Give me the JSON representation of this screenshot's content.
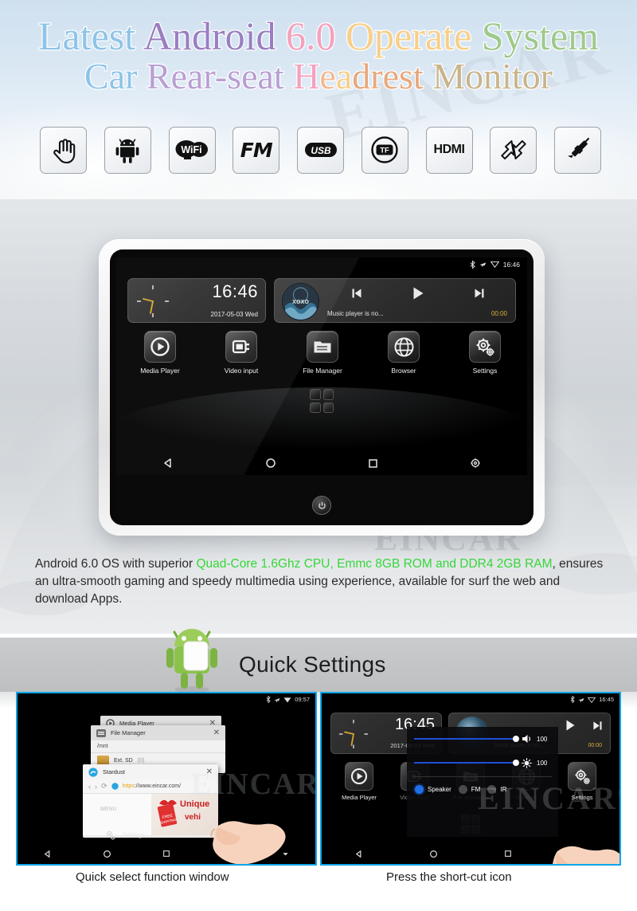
{
  "hero": {
    "watermark": "EINCAR",
    "title_line1": [
      {
        "text": "Latest ",
        "color": "#8fc4e8"
      },
      {
        "text": "Android ",
        "color": "#9a7fc0"
      },
      {
        "text": "6.0 ",
        "color": "#f3a2bd"
      },
      {
        "text": "Operate ",
        "color": "#f7cf8a"
      },
      {
        "text": "System",
        "color": "#9fc98d"
      }
    ],
    "title_line2": [
      {
        "text": "Car ",
        "color": "#8fc4e8"
      },
      {
        "text": "Rear-seat ",
        "color": "#b99fd2"
      },
      {
        "text": "H",
        "color": "#f3a2bd"
      },
      {
        "text": "e",
        "color": "#f5b98e"
      },
      {
        "text": "a",
        "color": "#f7cf8a"
      },
      {
        "text": "drest ",
        "color": "#e8a87c"
      },
      {
        "text": "Monitor",
        "color": "#c9b48a"
      }
    ],
    "title_text_1": "Latest Android 6.0 Operate System",
    "title_text_2": "Car Rear-seat Headrest Monitor"
  },
  "features": [
    {
      "name": "touch-gesture-icon",
      "label": "Touch"
    },
    {
      "name": "android-robot-icon",
      "label": "Android"
    },
    {
      "name": "wifi-icon",
      "label": "WiFi"
    },
    {
      "name": "fm-icon",
      "label": "FM"
    },
    {
      "name": "usb-icon",
      "label": "USB"
    },
    {
      "name": "tf-card-icon",
      "label": "TF"
    },
    {
      "name": "hdmi-icon",
      "label": "HDMI"
    },
    {
      "name": "mirror-link-icon",
      "label": "Mirror Link"
    },
    {
      "name": "av-cable-icon",
      "label": "AV Cable"
    }
  ],
  "device": {
    "band_watermark": "EINCAR",
    "band_watermark_sup": "®",
    "status_bar": {
      "time": "16:46",
      "icons": [
        "bluetooth-icon",
        "airplane-icon",
        "wifi-signal-icon"
      ]
    },
    "clock_widget": {
      "time": "16:46",
      "date": "2017-05-03  Wed"
    },
    "music_widget": {
      "title": "Music player is no...",
      "elapsed": "00:00",
      "controls": [
        "previous-track-icon",
        "play-icon",
        "next-track-icon"
      ]
    },
    "apps": [
      {
        "label": "Media Player",
        "icon": "media-player-icon"
      },
      {
        "label": "Video input",
        "icon": "video-input-icon"
      },
      {
        "label": "File Manager",
        "icon": "file-manager-icon"
      },
      {
        "label": "Browser",
        "icon": "browser-globe-icon"
      },
      {
        "label": "Settings",
        "icon": "settings-gears-icon"
      }
    ],
    "nav_buttons": [
      "back-icon",
      "home-icon",
      "recents-icon",
      "quick-settings-icon"
    ],
    "app_drawer": "app-drawer-grid-button",
    "power_button": "power-button"
  },
  "description": {
    "part1": "Android 6.0 OS with superior ",
    "highlight1": "Quad-Core 1.6Ghz CPU, Emmc 8GB ROM and DDR4 2GB RAM",
    "part2": ", ensures an ultra-smooth gaming and speedy multimedia using experience, available for surf the web and download Apps.",
    "highlight_color": "#35d63a"
  },
  "quick_settings": {
    "heading": "Quick Settings",
    "mascot": "android-marshmallow-mascot"
  },
  "left_shot": {
    "status_time": "09:57",
    "windows": [
      {
        "title": "Media Player",
        "icon": "media-player-icon"
      },
      {
        "title": "File Manager",
        "icon": "file-manager-icon",
        "path": "/mnt",
        "folder": "Ext. SD",
        "folder_count": "(0)"
      },
      {
        "title": "Stardust",
        "icon": "browser-stardust-icon",
        "url_scheme": "https",
        "url_rest": "://www.eincar.com/",
        "menu_label": "MENU"
      }
    ],
    "settings_label": "Settings",
    "ad_text_1": "Unique",
    "ad_text_2": "vehi",
    "ad_tag_1": "FREE",
    "ad_tag_2": "SHIPPING",
    "watermark": "EINCAR",
    "nav_buttons": [
      "back-icon",
      "home-icon",
      "recents-icon",
      "quick-settings-icon",
      "collapse-icon"
    ],
    "caption": "Quick select function window"
  },
  "right_shot": {
    "status_time": "16:45",
    "clock_time": "16:45",
    "clock_date": "2017-05-03  Wed",
    "music_title": "Music player is no...",
    "music_elapsed": "00:00",
    "sliders": [
      {
        "name": "volume",
        "icon": "volume-icon",
        "value": "100"
      },
      {
        "name": "brightness",
        "icon": "brightness-icon",
        "value": "100"
      }
    ],
    "radios": [
      {
        "label": "Speaker",
        "selected": true
      },
      {
        "label": "FM",
        "selected": false
      },
      {
        "label": "IR",
        "selected": false
      }
    ],
    "apps": [
      {
        "label": "Media Player"
      },
      {
        "label": "Video input"
      },
      {
        "label": "File Manager"
      },
      {
        "label": "Browser"
      },
      {
        "label": "Settings"
      }
    ],
    "watermark": "EINCAR",
    "watermark_sup": "®",
    "nav_buttons": [
      "back-icon",
      "home-icon",
      "recents-icon",
      "quick-settings-icon"
    ],
    "caption": "Press the short-cut icon"
  },
  "colors": {
    "accent_blue": "#0aa6ea",
    "highlight_green": "#35d63a",
    "slider_blue": "#1f4fd8",
    "music_time_gold": "#d9b03a"
  }
}
